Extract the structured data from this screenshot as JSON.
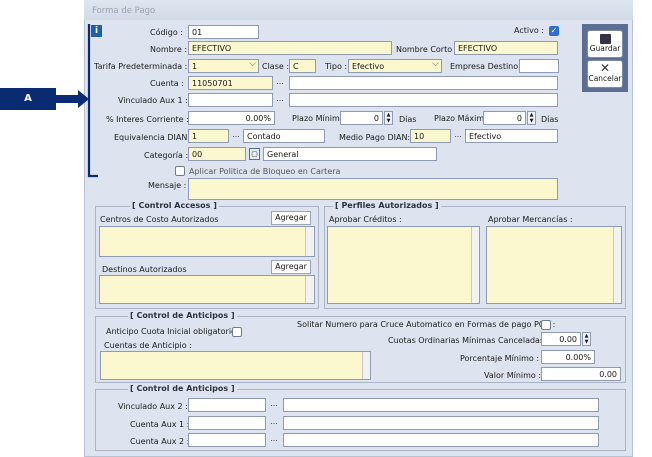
{
  "window": {
    "title": "Forma de Pago"
  },
  "callout": {
    "label": "A"
  },
  "toolbar": {
    "save_label": "Guardar",
    "cancel_label": "Cancelar"
  },
  "form": {
    "codigo_label": "Código :",
    "codigo_value": "01",
    "activo_label": "Activo :",
    "nombre_label": "Nombre :",
    "nombre_value": "EFECTIVO",
    "nombre_corto_label": "Nombre Corto :",
    "nombre_corto_value": "EFECTIVO",
    "tarifa_label": "Tarifa Predeterminada :",
    "tarifa_value": "1",
    "clase_label": "Clase :",
    "clase_value": "C",
    "tipo_label": "Tipo :",
    "tipo_value": "Efectivo",
    "empresa_destino_label": "Empresa Destino :",
    "cuenta_label": "Cuenta :",
    "cuenta_value": "11050701",
    "vinculado_label": "Vinculado Aux 1 :",
    "interes_label": "% Interes Corriente :",
    "interes_value": "0.00%",
    "plazo_min_label": "Plazo Mínimo :",
    "plazo_min_value": "0",
    "dias1": "Días",
    "plazo_max_label": "Plazo Máximo :",
    "plazo_max_value": "0",
    "dias2": "Días",
    "equivalencia_label": "Equivalencia DIAN:",
    "equivalencia_value": "1",
    "equivalencia_desc": "Contado",
    "medio_pago_label": "Medio Pago DIAN:",
    "medio_pago_value": "10",
    "medio_pago_desc": "Efectivo",
    "categoria_label": "Categoría :",
    "categoria_value": "00",
    "categoria_desc": "General",
    "bloqueo_label": "Aplicar Politica de Bloqueo en Cartera",
    "mensaje_label": "Mensaje :"
  },
  "control_accesos": {
    "title": "[ Control Accesos ]",
    "centros_label": "Centros de Costo Autorizados",
    "agregar1": "Agregar",
    "destinos_label": "Destinos Autorizados",
    "agregar2": "Agregar"
  },
  "perfiles": {
    "title": "[ Perfiles Autorizados ]",
    "creditos_label": "Aprobar Créditos :",
    "mercancias_label": "Aprobar Mercancías :"
  },
  "anticipos": {
    "title": "[ Control de Anticipos ]",
    "cuota_label": "Anticipo Cuota Inicial obligatorio :",
    "solicitar_label": "Solitar Numero para Cruce Automatico en Formas de pago POS :",
    "cuentas_label": "Cuentas de Anticipio :",
    "cuotas_label": "Cuotas Ordinarias Mínimas Canceladas :",
    "cuotas_value": "0.00",
    "porcentaje_label": "Porcentaje Mínimo :",
    "porcentaje_value": "0.00%",
    "valor_label": "Valor Mínimo :",
    "valor_value": "0.00"
  },
  "anticipos2": {
    "title": "[ Control de Anticipos ]",
    "vinc2_label": "Vinculado Aux 2 :",
    "cta1_label": "Cuenta Aux 1 :",
    "cta2_label": "Cuenta Aux 2 :"
  }
}
